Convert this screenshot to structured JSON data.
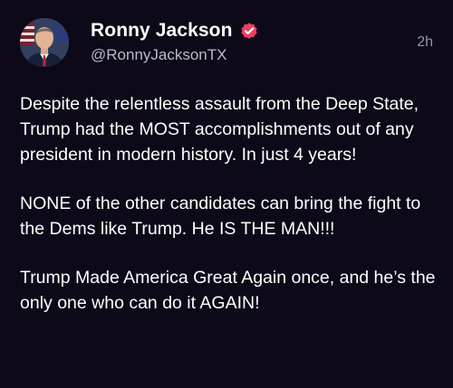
{
  "author": {
    "display_name": "Ronny Jackson",
    "handle": "@RonnyJacksonTX",
    "verified_icon": "verified-badge-icon",
    "avatar_icon": "profile-photo"
  },
  "post": {
    "timestamp": "2h",
    "paragraphs": [
      "Despite the relentless assault from the Deep State, Trump had the MOST accomplishments out of any president in modern history. In just 4 years!",
      "NONE of the other candidates can bring the fight to the Dems like Trump. He IS THE MAN!!!",
      "Trump Made America Great Again once, and he’s the only one who can do it AGAIN!"
    ]
  },
  "colors": {
    "background": "#0d0918",
    "verified": "#ec3f63",
    "text": "#ffffff",
    "muted": "#bdb8c7"
  }
}
